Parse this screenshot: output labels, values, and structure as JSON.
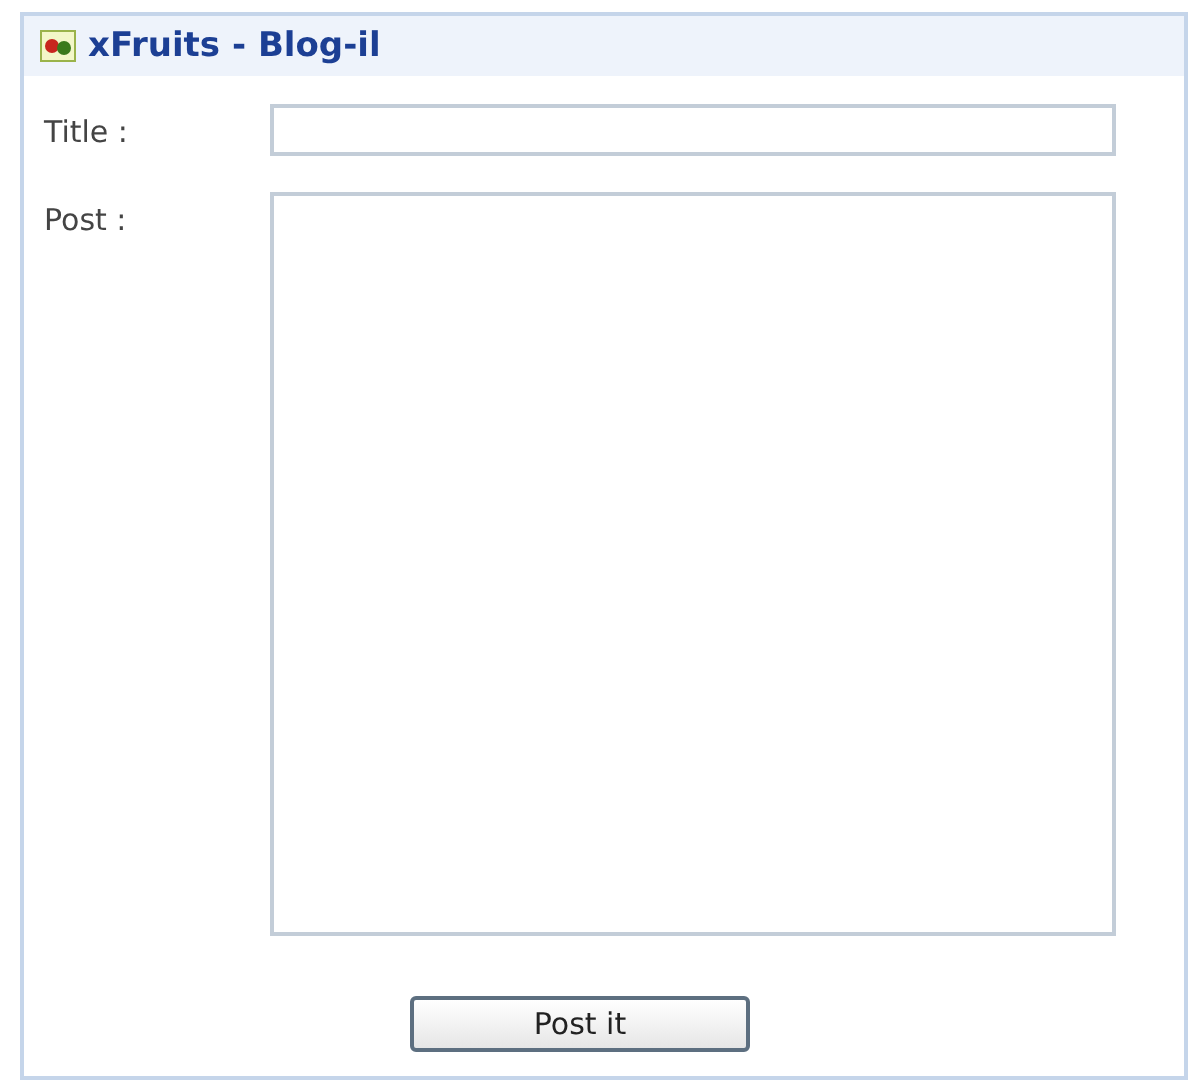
{
  "window": {
    "title": "xFruits - Blog-il"
  },
  "fields": [
    {
      "kind": "line",
      "label": "Title :"
    },
    {
      "kind": "area",
      "label": "Post :"
    }
  ],
  "button": "Post it"
}
